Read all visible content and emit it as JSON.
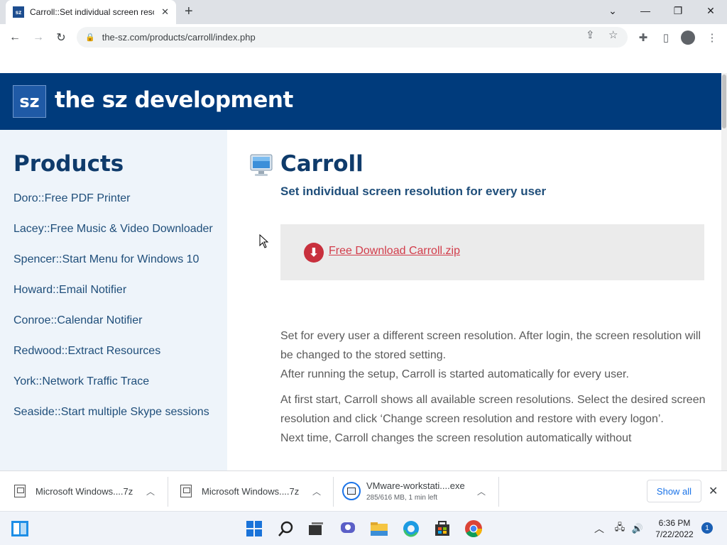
{
  "browser": {
    "tab_title": "Carroll::Set individual screen reso",
    "tab_favicon": "sz",
    "url": "the-sz.com/products/carroll/index.php"
  },
  "site": {
    "logo_text": "sz",
    "title": "the sz development"
  },
  "sidebar": {
    "heading": "Products",
    "items": [
      {
        "label": "Doro::Free PDF Printer"
      },
      {
        "label": "Lacey::Free Music & Video Downloader"
      },
      {
        "label": "Spencer::Start Menu for Windows 10"
      },
      {
        "label": "Howard::Email Notifier"
      },
      {
        "label": "Conroe::Calendar Notifier"
      },
      {
        "label": "Redwood::Extract Resources"
      },
      {
        "label": "York::Network Traffic Trace"
      },
      {
        "label": "Seaside::Start multiple Skype sessions"
      }
    ]
  },
  "product": {
    "title": "Carroll",
    "subtitle": "Set individual screen resolution for every user",
    "download_label": "Free Download Carroll.zip",
    "paragraphs": [
      "Set for every user a different screen resolution. After login, the screen resolution will be changed to the stored setting.",
      "After running the setup, Carroll is started automatically for every user.",
      "At first start, Carroll shows all available screen resolutions. Select the desired screen resolution and click ‘Change screen resolution and restore with every logon’.",
      "Next time, Carroll changes the screen resolution automatically without"
    ]
  },
  "downloads": {
    "items": [
      {
        "name": "Microsoft Windows....7z",
        "status": ""
      },
      {
        "name": "Microsoft Windows....7z",
        "status": ""
      },
      {
        "name": "VMware-workstati....exe",
        "status": "285/616 MB, 1 min left",
        "progress": 0.46
      }
    ],
    "show_all_label": "Show all"
  },
  "taskbar": {
    "time": "6:36 PM",
    "date": "7/22/2022",
    "notification_count": "1"
  }
}
